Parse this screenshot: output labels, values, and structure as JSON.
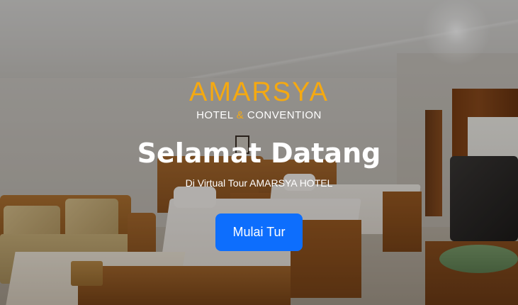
{
  "brand": {
    "name": "AMARSYA",
    "sub_part1": "HOTEL ",
    "sub_amp": "&",
    "sub_part2": " CONVENTION"
  },
  "hero": {
    "title": "Selamat Datang",
    "subtitle": "Di Virtual Tour AMARSYA HOTEL",
    "button_label": "Mulai Tur"
  },
  "colors": {
    "brand_accent": "#f5a911",
    "button_bg": "#0d6efd",
    "text": "#ffffff"
  }
}
